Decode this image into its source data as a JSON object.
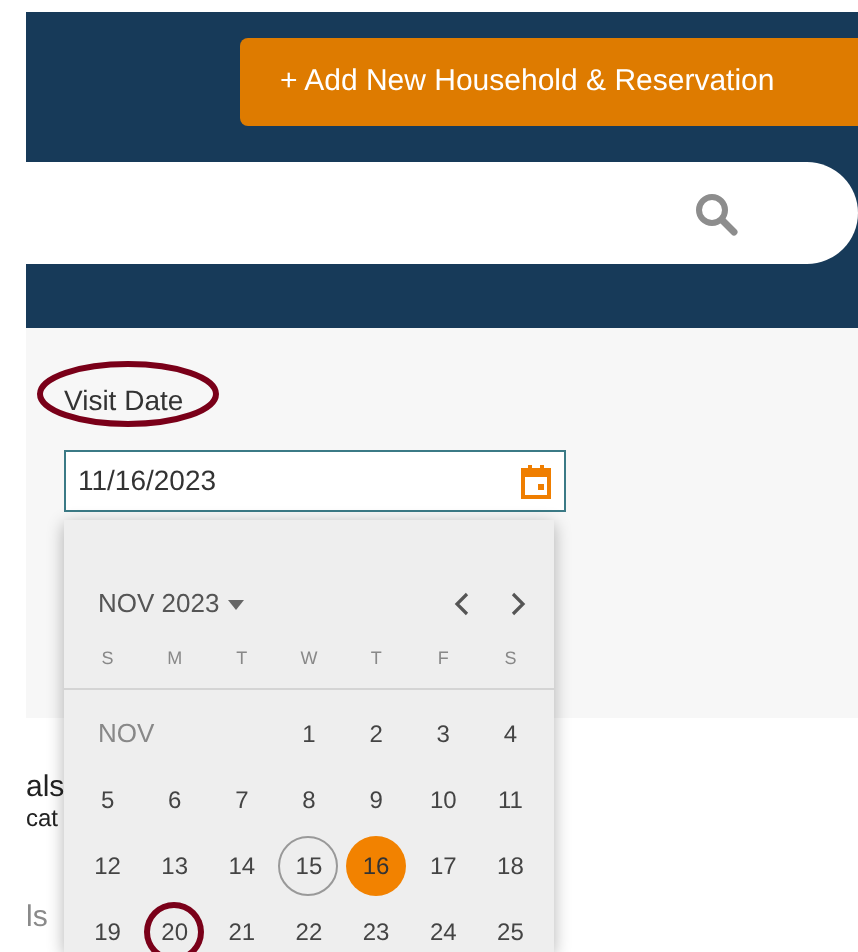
{
  "header": {
    "add_button": {
      "label": "+ Add New Household & Reservation"
    }
  },
  "visit_date": {
    "label": "Visit Date",
    "value": "11/16/2023",
    "annotated": true
  },
  "background_fragments": [
    {
      "text": "als",
      "kind": "title"
    },
    {
      "text": "cat",
      "kind": "subtitle"
    },
    {
      "text": "ls",
      "kind": "link"
    }
  ],
  "calendar": {
    "month_label": "NOV 2023",
    "weekdays": [
      "S",
      "M",
      "T",
      "W",
      "T",
      "F",
      "S"
    ],
    "month_short": "NOV",
    "days": [
      {
        "label": "1",
        "selected": false,
        "today": false,
        "circled": false
      },
      {
        "label": "2",
        "selected": false,
        "today": false,
        "circled": false
      },
      {
        "label": "3",
        "selected": false,
        "today": false,
        "circled": false
      },
      {
        "label": "4",
        "selected": false,
        "today": false,
        "circled": false
      },
      {
        "label": "5",
        "selected": false,
        "today": false,
        "circled": false
      },
      {
        "label": "6",
        "selected": false,
        "today": false,
        "circled": false
      },
      {
        "label": "7",
        "selected": false,
        "today": false,
        "circled": false
      },
      {
        "label": "8",
        "selected": false,
        "today": false,
        "circled": false
      },
      {
        "label": "9",
        "selected": false,
        "today": false,
        "circled": false
      },
      {
        "label": "10",
        "selected": false,
        "today": false,
        "circled": false
      },
      {
        "label": "11",
        "selected": false,
        "today": false,
        "circled": false
      },
      {
        "label": "12",
        "selected": false,
        "today": false,
        "circled": false
      },
      {
        "label": "13",
        "selected": false,
        "today": false,
        "circled": false
      },
      {
        "label": "14",
        "selected": false,
        "today": false,
        "circled": false
      },
      {
        "label": "15",
        "selected": false,
        "today": true,
        "circled": false
      },
      {
        "label": "16",
        "selected": true,
        "today": false,
        "circled": false
      },
      {
        "label": "17",
        "selected": false,
        "today": false,
        "circled": false
      },
      {
        "label": "18",
        "selected": false,
        "today": false,
        "circled": false
      },
      {
        "label": "19",
        "selected": false,
        "today": false,
        "circled": false
      },
      {
        "label": "20",
        "selected": false,
        "today": false,
        "circled": true
      },
      {
        "label": "21",
        "selected": false,
        "today": false,
        "circled": false
      },
      {
        "label": "22",
        "selected": false,
        "today": false,
        "circled": false
      },
      {
        "label": "23",
        "selected": false,
        "today": false,
        "circled": false
      },
      {
        "label": "24",
        "selected": false,
        "today": false,
        "circled": false
      },
      {
        "label": "25",
        "selected": false,
        "today": false,
        "circled": false
      }
    ]
  }
}
